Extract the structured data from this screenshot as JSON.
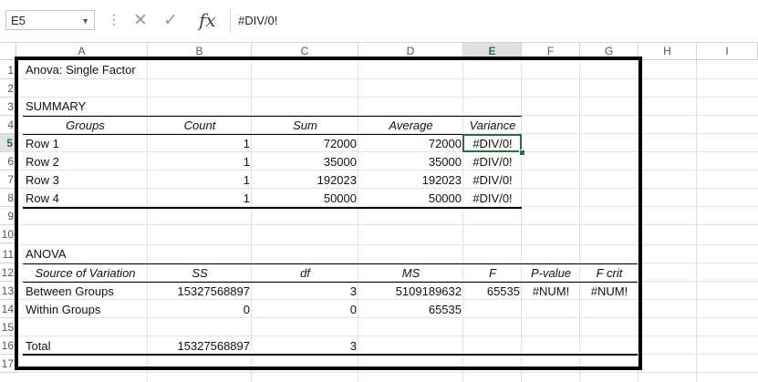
{
  "formula_bar": {
    "name_box": "E5",
    "formula": "#DIV/0!",
    "fx_label": "fx",
    "cancel_glyph": "✕",
    "enter_glyph": "✓",
    "dropdown_glyph": "▼",
    "dots": "⋮"
  },
  "columns": [
    "A",
    "B",
    "C",
    "D",
    "E",
    "F",
    "G",
    "H",
    "I"
  ],
  "rows": [
    "1",
    "2",
    "3",
    "4",
    "5",
    "6",
    "7",
    "8",
    "9",
    "10",
    "11",
    "12",
    "13",
    "14",
    "15",
    "16",
    "17"
  ],
  "active_cell": {
    "col": "E",
    "row": "5"
  },
  "cells": {
    "a1": "Anova: Single Factor",
    "a3": "SUMMARY",
    "summary_headers": [
      "Groups",
      "Count",
      "Sum",
      "Average",
      "Variance"
    ],
    "summary_rows": [
      [
        "Row 1",
        "1",
        "72000",
        "72000",
        "#DIV/0!"
      ],
      [
        "Row 2",
        "1",
        "35000",
        "35000",
        "#DIV/0!"
      ],
      [
        "Row 3",
        "1",
        "192023",
        "192023",
        "#DIV/0!"
      ],
      [
        "Row 4",
        "1",
        "50000",
        "50000",
        "#DIV/0!"
      ]
    ],
    "a11": "ANOVA",
    "anova_headers": [
      "Source of Variation",
      "SS",
      "df",
      "MS",
      "F",
      "P-value",
      "F crit"
    ],
    "anova_rows": [
      [
        "Between Groups",
        "15327568897",
        "3",
        "5109189632",
        "65535",
        "#NUM!",
        "#NUM!"
      ],
      [
        "Within Groups",
        "0",
        "0",
        "65535",
        "",
        "",
        ""
      ]
    ],
    "total_row": [
      "Total",
      "15327568897",
      "3"
    ]
  },
  "colors": {
    "accent": "#217346",
    "gridline": "#e3e3e3",
    "header_bg": "#e1e1e1"
  }
}
